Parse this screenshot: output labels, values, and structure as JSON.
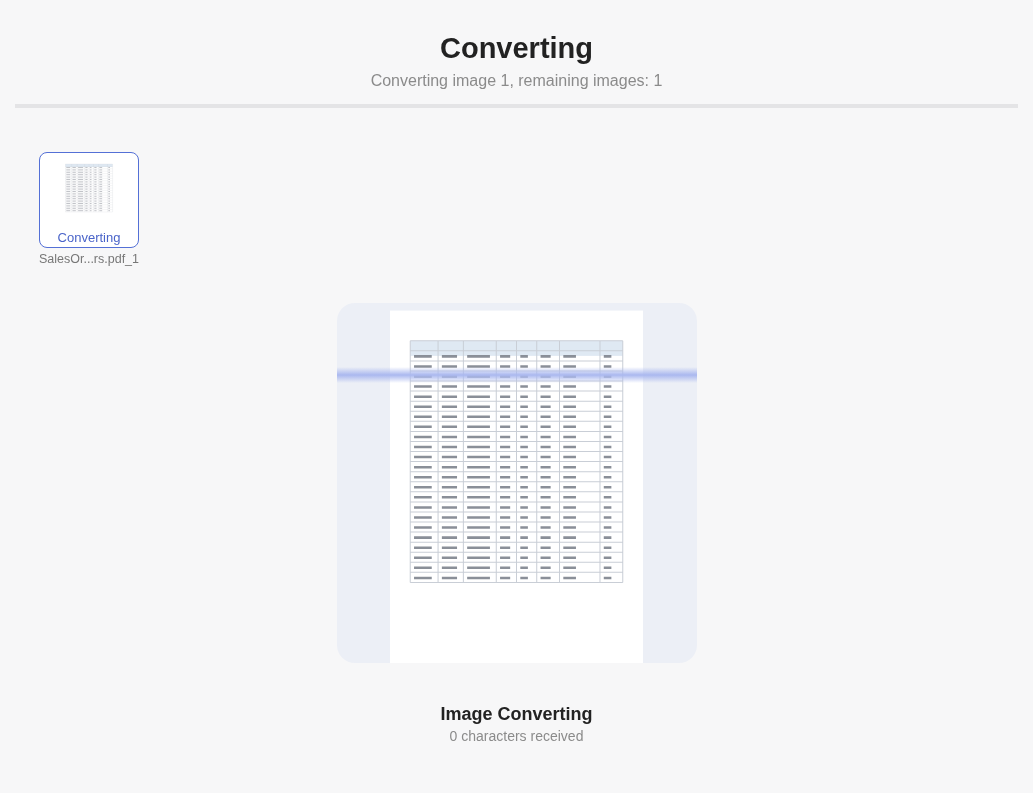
{
  "header": {
    "title": "Converting",
    "subtitle": "Converting image 1, remaining images: 1"
  },
  "files": [
    {
      "status": "Converting",
      "name": "SalesOr...rs.pdf_1",
      "selected": true
    }
  ],
  "preview": {
    "kind": "picture",
    "scanning": true
  },
  "footer": {
    "title": "Image Converting",
    "caption": "0 characters received"
  }
}
